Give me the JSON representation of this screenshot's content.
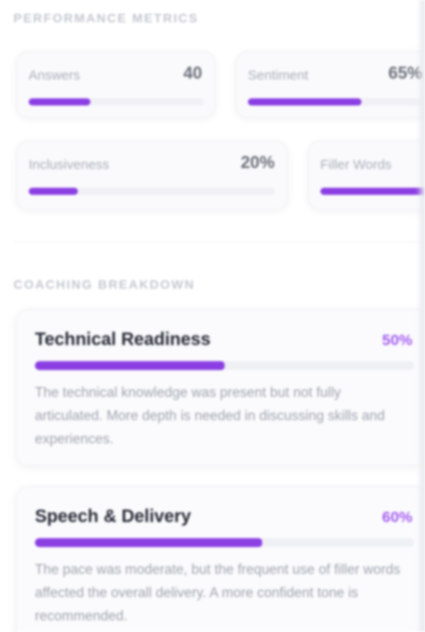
{
  "performance": {
    "heading": "PERFORMANCE METRICS",
    "metrics": [
      {
        "label": "Answers",
        "value": "40",
        "progress": 0.35
      },
      {
        "label": "Sentiment",
        "value": "65%",
        "progress": 0.65
      },
      {
        "label": "Inclusiveness",
        "value": "20%",
        "progress": 0.2
      },
      {
        "label": "Filler Words",
        "value": "",
        "progress": 1.0
      }
    ]
  },
  "coaching": {
    "heading": "COACHING BREAKDOWN",
    "items": [
      {
        "title": "Technical Readiness",
        "score": "50%",
        "progress": 0.5,
        "description": "The technical knowledge was present but not fully articulated. More depth is needed in discussing skills and experiences."
      },
      {
        "title": "Speech & Delivery",
        "score": "60%",
        "progress": 0.6,
        "description": "The pace was moderate, but the frequent use of filler words affected the overall delivery. A more confident tone is recommended."
      }
    ]
  },
  "colors": {
    "accent": "#8b3fe3",
    "accent_text": "#a45cf0",
    "track": "#eef0f4"
  }
}
